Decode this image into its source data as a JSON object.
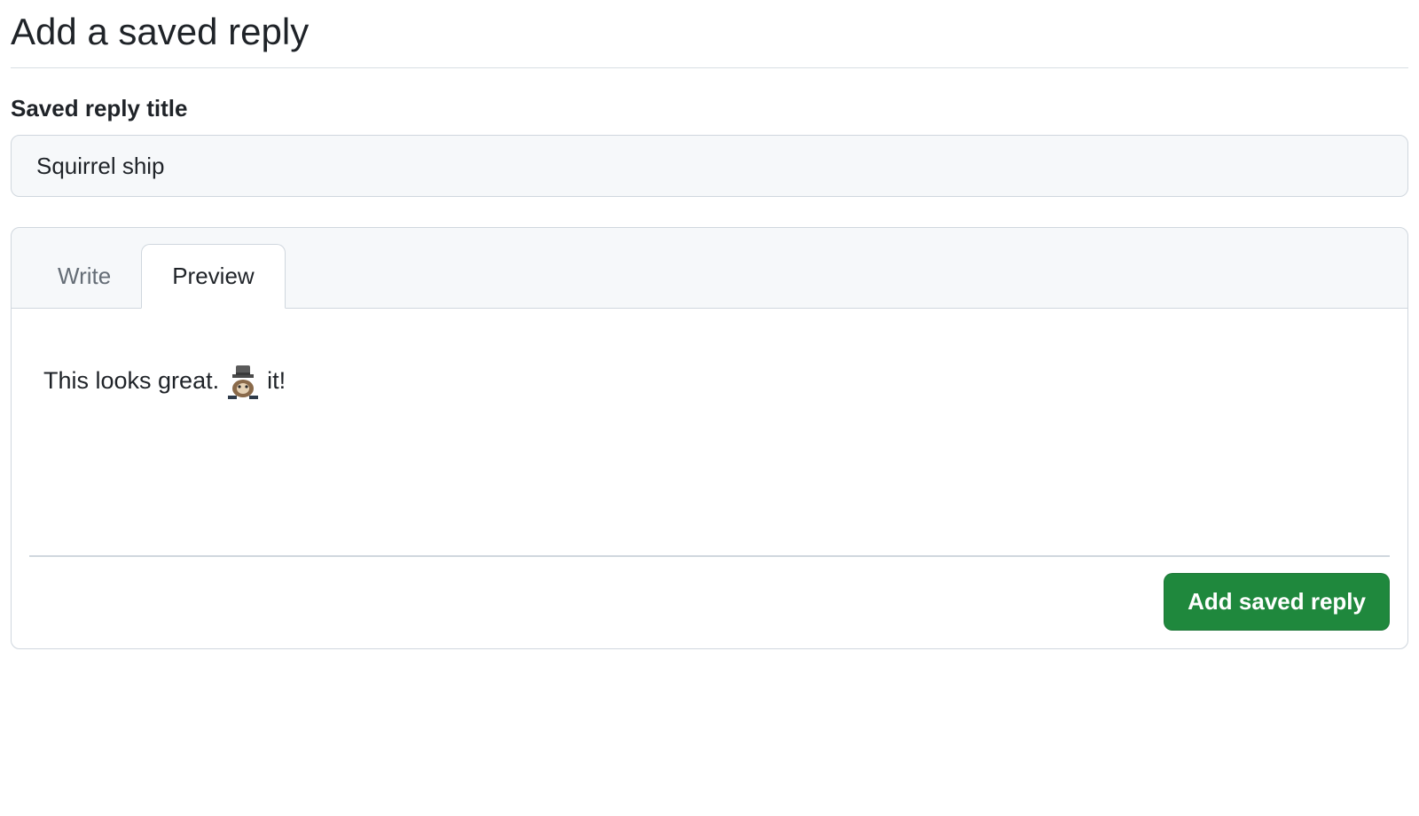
{
  "page_title": "Add a saved reply",
  "title_field": {
    "label": "Saved reply title",
    "value": "Squirrel ship"
  },
  "editor": {
    "tabs": {
      "write": "Write",
      "preview": "Preview",
      "active": "preview"
    },
    "preview": {
      "text_before_emoji": "This looks great.",
      "emoji_name": "shipit-squirrel",
      "text_after_emoji": " it!"
    }
  },
  "actions": {
    "submit_label": "Add saved reply"
  },
  "colors": {
    "primary_button": "#1f883d",
    "border": "#d0d7de",
    "header_bg": "#f6f8fa"
  }
}
